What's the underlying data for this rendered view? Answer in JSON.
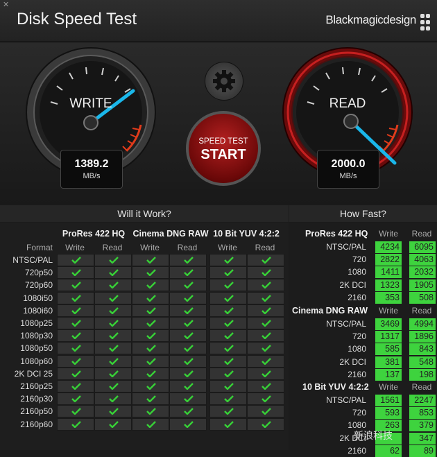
{
  "window": {
    "close_label": "✕",
    "title": "Disk Speed Test",
    "brand": "Blackmagicdesign"
  },
  "write_gauge": {
    "label": "WRITE",
    "value": "1389.2",
    "unit": "MB/s"
  },
  "read_gauge": {
    "label": "READ",
    "value": "2000.0",
    "unit": "MB/s"
  },
  "controls": {
    "settings_icon": "gear-icon",
    "start_top": "SPEED TEST",
    "start_bottom": "START"
  },
  "will_it_work": {
    "title": "Will it Work?",
    "format_header": "Format",
    "groups": [
      "ProRes 422 HQ",
      "Cinema DNG RAW",
      "10 Bit YUV 4:2:2"
    ],
    "subheads": [
      "Write",
      "Read"
    ],
    "formats": [
      "NTSC/PAL",
      "720p50",
      "720p60",
      "1080i50",
      "1080i60",
      "1080p25",
      "1080p30",
      "1080p50",
      "1080p60",
      "2K DCI 25",
      "2160p25",
      "2160p30",
      "2160p50",
      "2160p60"
    ]
  },
  "how_fast": {
    "title": "How Fast?",
    "subheads": [
      "Write",
      "Read"
    ],
    "groups": [
      {
        "name": "ProRes 422 HQ",
        "rows": [
          {
            "label": "NTSC/PAL",
            "write": "4234",
            "read": "6095"
          },
          {
            "label": "720",
            "write": "2822",
            "read": "4063"
          },
          {
            "label": "1080",
            "write": "1411",
            "read": "2032"
          },
          {
            "label": "2K DCI",
            "write": "1323",
            "read": "1905"
          },
          {
            "label": "2160",
            "write": "353",
            "read": "508"
          }
        ]
      },
      {
        "name": "Cinema DNG RAW",
        "rows": [
          {
            "label": "NTSC/PAL",
            "write": "3469",
            "read": "4994"
          },
          {
            "label": "720",
            "write": "1317",
            "read": "1896"
          },
          {
            "label": "1080",
            "write": "585",
            "read": "843"
          },
          {
            "label": "2K DCI",
            "write": "381",
            "read": "548"
          },
          {
            "label": "2160",
            "write": "137",
            "read": "198"
          }
        ]
      },
      {
        "name": "10 Bit YUV 4:2:2",
        "rows": [
          {
            "label": "NTSC/PAL",
            "write": "1561",
            "read": "2247"
          },
          {
            "label": "720",
            "write": "593",
            "read": "853"
          },
          {
            "label": "1080",
            "write": "263",
            "read": "379"
          },
          {
            "label": "2K DCI",
            "write": "",
            "read": "347"
          },
          {
            "label": "2160",
            "write": "62",
            "read": "89"
          }
        ]
      }
    ]
  },
  "watermark": "新浪科技",
  "colors": {
    "accent_blue": "#1ab7ea",
    "read_ring": "#b01818",
    "good_green": "#3ed33e"
  }
}
